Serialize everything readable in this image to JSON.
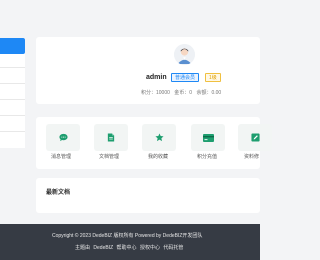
{
  "sidebar": {
    "items": [
      "",
      "",
      "",
      "",
      "",
      ""
    ]
  },
  "profile": {
    "avatar_icon": "user-avatar-icon",
    "username": "admin",
    "member_badge": "普通会员",
    "level_badge": "1级",
    "stats": {
      "points": "积分：10000",
      "coins": "金币：0",
      "balance": "余额：0.00"
    }
  },
  "quick_actions": [
    {
      "label": "消息管理",
      "icon": "message-icon",
      "color": "#1e9e6f"
    },
    {
      "label": "文档管理",
      "icon": "document-icon",
      "color": "#1e9e6f"
    },
    {
      "label": "我的收藏",
      "icon": "star-icon",
      "color": "#1e9e6f"
    },
    {
      "label": "积分充值",
      "icon": "card-icon",
      "color": "#1e9e6f"
    },
    {
      "label": "资料修",
      "icon": "edit-icon",
      "color": "#1e9e6f"
    }
  ],
  "docs": {
    "title": "最新文档"
  },
  "footer": {
    "copyright": "Copyright © 2023 DedeBIZ 版权所有 Powered by DedeBIZ开发团队",
    "links": [
      "主题由",
      "DedeBIZ",
      "帮助中心",
      "授权中心",
      "代码托管"
    ]
  },
  "colors": {
    "accent": "#1e88f5",
    "footer_bg": "#363b44",
    "icon_green": "#1e9e6f"
  }
}
